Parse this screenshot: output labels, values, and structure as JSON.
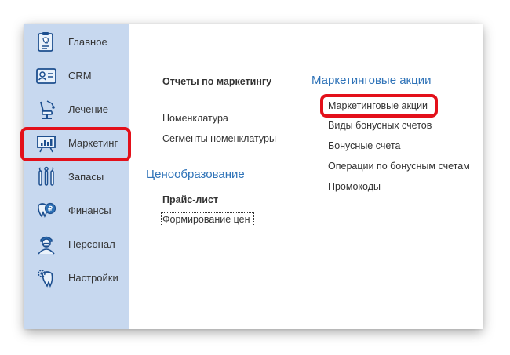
{
  "sidebar": {
    "items": [
      {
        "label": "Главное",
        "icon": "clipboard-tooth-icon"
      },
      {
        "label": "CRM",
        "icon": "id-card-icon"
      },
      {
        "label": "Лечение",
        "icon": "dental-chair-icon"
      },
      {
        "label": "Маркетинг",
        "icon": "presentation-chart-icon"
      },
      {
        "label": "Запасы",
        "icon": "dental-tools-icon"
      },
      {
        "label": "Финансы",
        "icon": "tooth-coin-icon"
      },
      {
        "label": "Персонал",
        "icon": "doctor-icon"
      },
      {
        "label": "Настройки",
        "icon": "tooth-gear-icon"
      }
    ],
    "selected": "Маркетинг"
  },
  "main": {
    "reports_header": "Отчеты по маркетингу",
    "nomenclature": "Номенклатура",
    "nomenclature_segments": "Сегменты номенклатуры",
    "pricing_title": "Ценообразование",
    "price_list": "Прайс-лист",
    "price_formation": "Формирование цен",
    "promo_title": "Маркетинговые акции",
    "promo_links": [
      "Маркетинговые акции",
      "Виды бонусных счетов",
      "Бонусные счета",
      "Операции по бонусным счетам",
      "Промокоды"
    ]
  },
  "colors": {
    "sidebar_bg": "#c7d8ef",
    "section_title": "#2f73b8",
    "highlight": "#e3101a"
  }
}
